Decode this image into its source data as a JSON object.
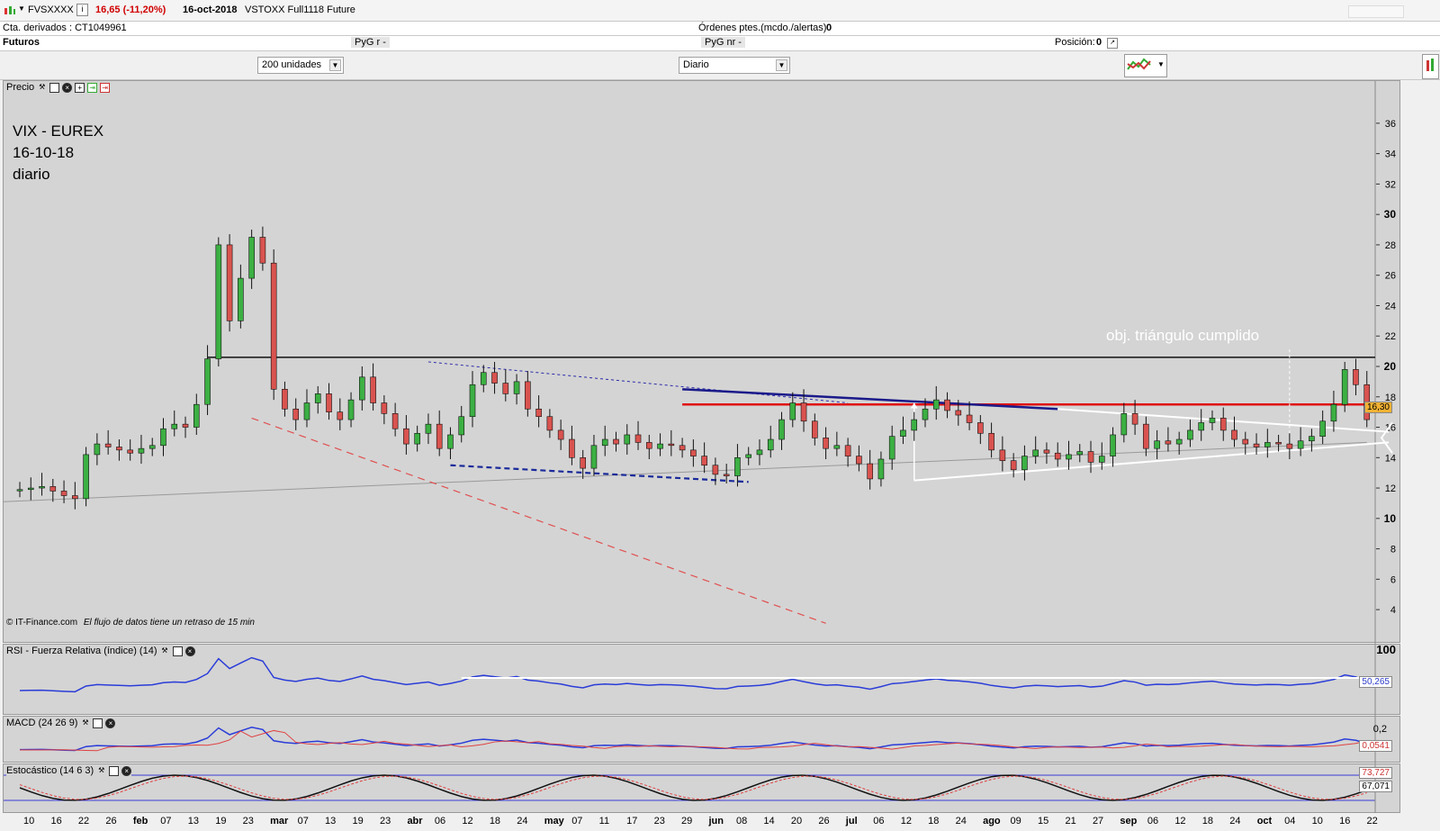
{
  "header": {
    "symbol": "FVSXXXX",
    "change": "16,65 (-11,20%)",
    "date": "16-oct-2018",
    "instrument": "VSTOXX Full1118 Future"
  },
  "account": {
    "label": "Cta. derivados : CT1049961",
    "pending_label": "Órdenes ptes.(mcdo./alertas)",
    "pending_value": "0",
    "futures_label": "Futuros",
    "pyg_r": "PyG r",
    "pyg_r_val": "-",
    "pyg_nr": "PyG nr",
    "pyg_nr_val": "-",
    "position_label": "Posición:",
    "position_value": "0"
  },
  "controls": {
    "units": "200 unidades",
    "period": "Diario"
  },
  "price_panel": {
    "title": "Precio",
    "note_title_1": "VIX - EUREX",
    "note_title_2": "16-10-18",
    "note_title_3": "diario",
    "annotation": "obj. triángulo cumplido",
    "credit": "© IT-Finance.com",
    "credit_note": "El flujo de datos tiene un retraso de 15 min",
    "last_badge": "16,30",
    "yticks": [
      "36",
      "34",
      "32",
      "30",
      "28",
      "26",
      "24",
      "22",
      "20",
      "18",
      "16",
      "14",
      "12",
      "10",
      "8",
      "6",
      "4"
    ]
  },
  "rsi_panel": {
    "title": "RSI - Fuerza Relativa (índice) (14)",
    "top": "100",
    "badge": "50,265"
  },
  "macd_panel": {
    "title": "MACD (24 26 9)",
    "top": "0,2",
    "badge": "0,0541"
  },
  "stoch_panel": {
    "title": "Estocástico (14 6 3)",
    "badge1": "73,727",
    "badge2": "67,071"
  },
  "xaxis": {
    "labels": [
      "10",
      "16",
      "22",
      "26",
      "feb",
      "07",
      "13",
      "19",
      "23",
      "mar",
      "07",
      "13",
      "19",
      "23",
      "abr",
      "06",
      "12",
      "18",
      "24",
      "may",
      "07",
      "11",
      "17",
      "23",
      "29",
      "jun",
      "08",
      "14",
      "20",
      "26",
      "jul",
      "06",
      "12",
      "18",
      "24",
      "ago",
      "09",
      "15",
      "21",
      "27",
      "sep",
      "06",
      "12",
      "18",
      "24",
      "oct",
      "04",
      "10",
      "16",
      "22"
    ]
  },
  "chart_data": {
    "type": "candlestick",
    "title": "VIX - EUREX",
    "ylim": [
      3,
      37
    ],
    "month_ticks": [
      "feb",
      "mar",
      "abr",
      "may",
      "jun",
      "jul",
      "ago",
      "sep",
      "oct"
    ],
    "close_series": [
      11.9,
      12.0,
      12.1,
      11.8,
      11.5,
      11.3,
      14.2,
      14.9,
      14.7,
      14.5,
      14.3,
      14.6,
      14.8,
      15.9,
      16.2,
      16.0,
      17.5,
      20.5,
      28.0,
      23.0,
      25.8,
      28.5,
      26.8,
      18.5,
      17.2,
      16.5,
      17.6,
      18.2,
      17.0,
      16.5,
      17.8,
      19.3,
      17.6,
      16.9,
      15.9,
      14.9,
      15.6,
      16.2,
      14.6,
      15.5,
      16.7,
      18.8,
      19.6,
      18.9,
      18.2,
      19.0,
      17.2,
      16.7,
      15.8,
      15.2,
      14.0,
      13.3,
      14.8,
      15.2,
      14.9,
      15.5,
      15.0,
      14.6,
      14.9,
      14.8,
      14.5,
      14.1,
      13.5,
      12.9,
      12.8,
      14.0,
      14.2,
      14.5,
      15.2,
      16.5,
      17.6,
      16.4,
      15.3,
      14.6,
      14.8,
      14.1,
      13.6,
      12.6,
      13.9,
      15.4,
      15.8,
      16.5,
      17.2,
      17.8,
      17.1,
      16.8,
      16.3,
      15.6,
      14.5,
      13.8,
      13.2,
      14.1,
      14.5,
      14.3,
      13.9,
      14.2,
      14.4,
      13.7,
      14.1,
      15.5,
      16.9,
      16.2,
      14.6,
      15.1,
      14.9,
      15.2,
      15.8,
      16.3,
      16.6,
      15.8,
      15.2,
      14.9,
      14.7,
      15.0,
      14.9,
      14.6,
      15.1,
      15.4,
      16.4,
      17.5,
      19.8,
      18.8,
      16.5
    ],
    "resistance": 20.6,
    "red_line": 17.5,
    "last": 16.3,
    "rsi_last": 50.265,
    "macd_last": 0.0541,
    "stoch_last": [
      73.727,
      67.071
    ]
  }
}
